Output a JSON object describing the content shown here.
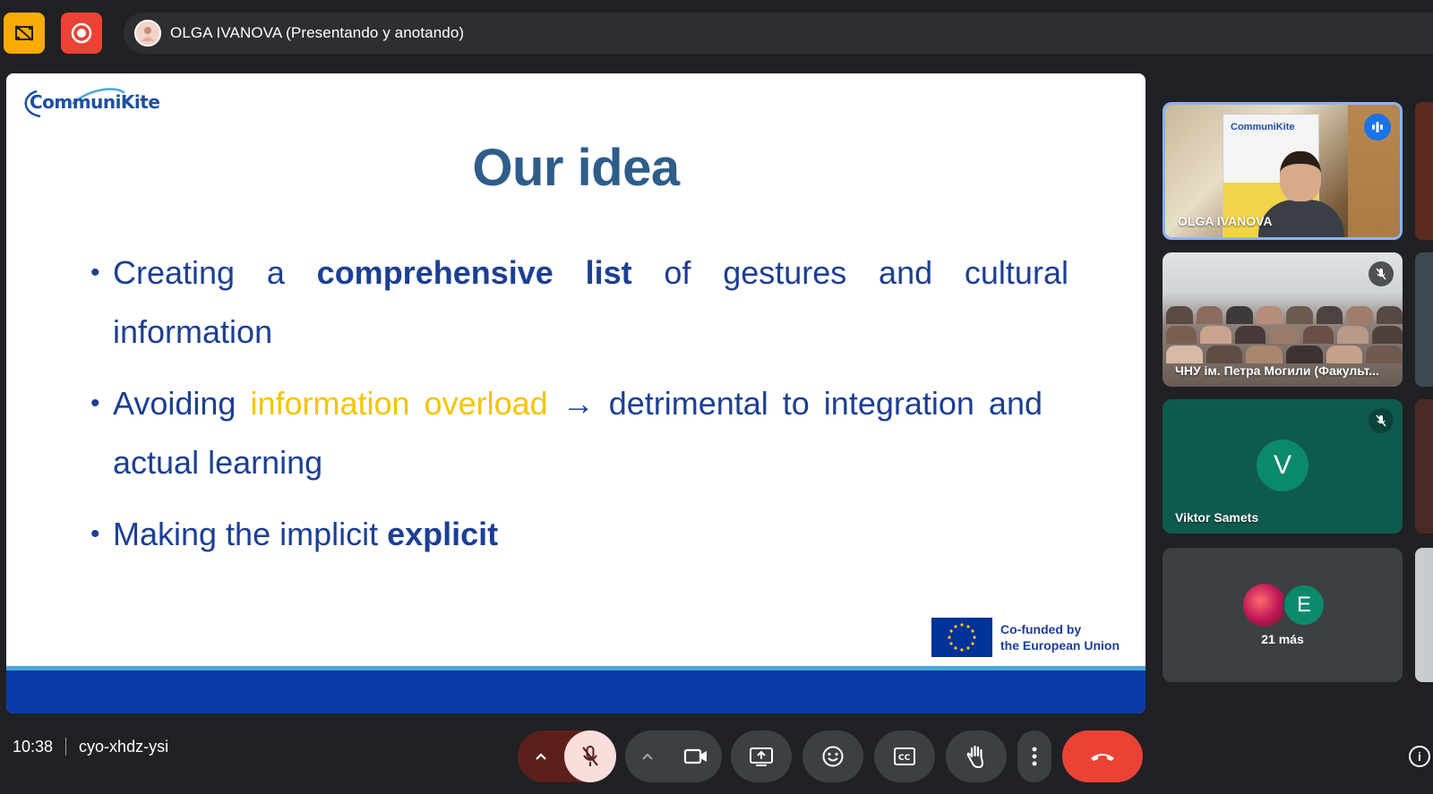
{
  "topbar": {
    "presenter_status": "OLGA IVANOVA (Presentando y anotando)",
    "icons": {
      "left": "no-video-icon",
      "record": "record-icon"
    }
  },
  "slide": {
    "logo_text": "CommuniKite",
    "title": "Our idea",
    "bullets": [
      {
        "words_line1": [
          "Creating",
          "a",
          "comprehensive",
          "list",
          "of",
          "gestures",
          "and",
          "cultural"
        ],
        "bold_words": [
          "comprehensive",
          "list"
        ],
        "line2": "information"
      },
      {
        "prefix": "Avoiding",
        "highlight": "information overload",
        "arrow": "→",
        "suffix": "detrimental to integration and actual learning"
      },
      {
        "prefix": "Making the implicit",
        "bold": "explicit"
      }
    ],
    "eu_badge": {
      "line1": "Co-funded by",
      "line2": "the European Union"
    },
    "colors": {
      "title": "#2e5d8a",
      "body": "#1c3f94",
      "highlight": "#f5c400",
      "footer": "#0a3aa8"
    }
  },
  "participants": [
    {
      "name": "OLGA IVANOVA",
      "speaking": true,
      "banner_text": "CommuniKite"
    },
    {
      "name": "ЧНУ ім. Петра Могили (Факульт...",
      "muted": true
    },
    {
      "name": "Viktor Samets",
      "initial": "V",
      "muted": true
    },
    {
      "initial": "E",
      "more_label": "21 más"
    }
  ],
  "bottombar": {
    "time": "10:38",
    "meeting_code": "cyo-xhdz-ysi",
    "controls": [
      "mic-options-chevron",
      "mic-off-icon",
      "camera-options-chevron",
      "camera-icon",
      "present-icon",
      "emoji-icon",
      "captions-icon",
      "raise-hand-icon",
      "more-options-icon",
      "hang-up-icon"
    ]
  }
}
